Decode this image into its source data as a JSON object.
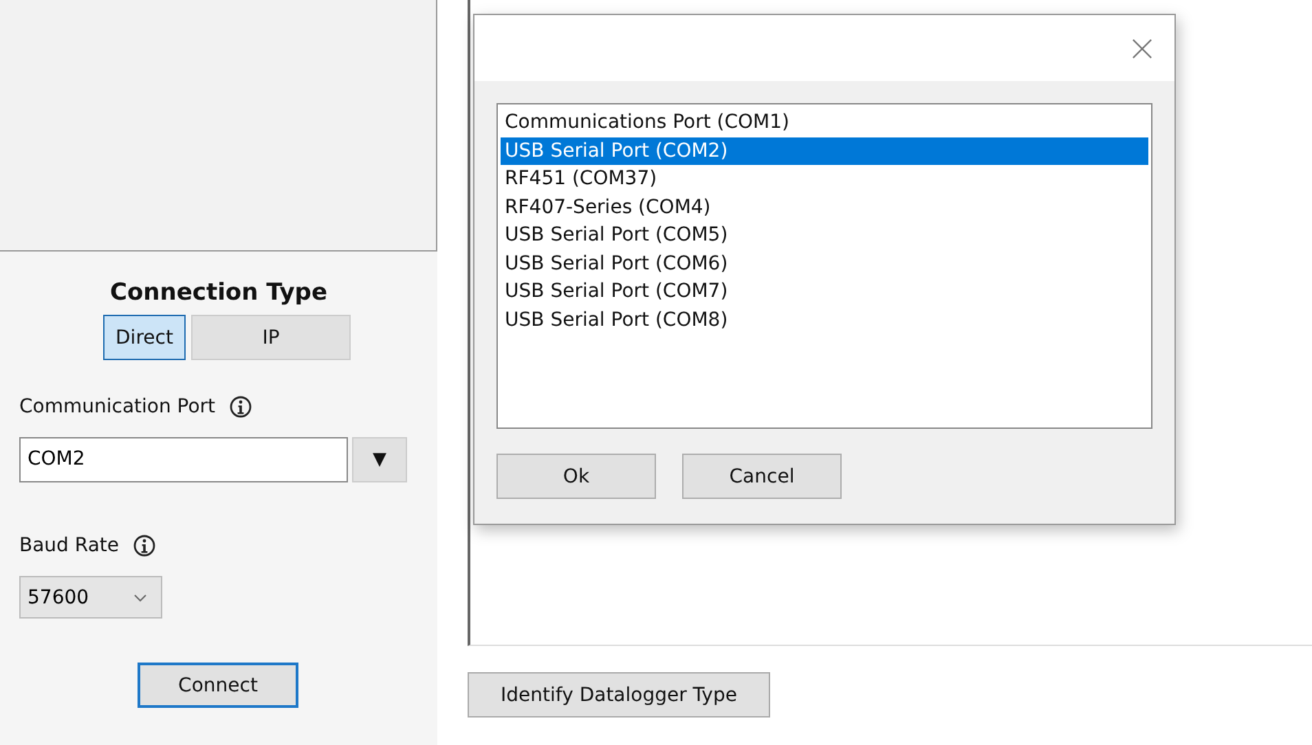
{
  "connection_type": {
    "title": "Connection Type",
    "options": [
      {
        "label": "Direct",
        "selected": true
      },
      {
        "label": "IP",
        "selected": false
      }
    ]
  },
  "communication_port": {
    "label": "Communication Port",
    "value": "COM2",
    "dropdown_glyph": "▼"
  },
  "baud_rate": {
    "label": "Baud Rate",
    "value": "57600"
  },
  "connect_button": "Connect",
  "identify_button": "Identify Datalogger Type",
  "dialog": {
    "ports": [
      {
        "label": "Communications Port (COM1)",
        "selected": false
      },
      {
        "label": "USB Serial Port (COM2)",
        "selected": true
      },
      {
        "label": "RF451 (COM37)",
        "selected": false
      },
      {
        "label": "RF407-Series (COM4)",
        "selected": false
      },
      {
        "label": "USB Serial Port (COM5)",
        "selected": false
      },
      {
        "label": "USB Serial Port (COM6)",
        "selected": false
      },
      {
        "label": "USB Serial Port (COM7)",
        "selected": false
      },
      {
        "label": "USB Serial Port (COM8)",
        "selected": false
      }
    ],
    "buttons": [
      "Ok",
      "Cancel"
    ]
  }
}
